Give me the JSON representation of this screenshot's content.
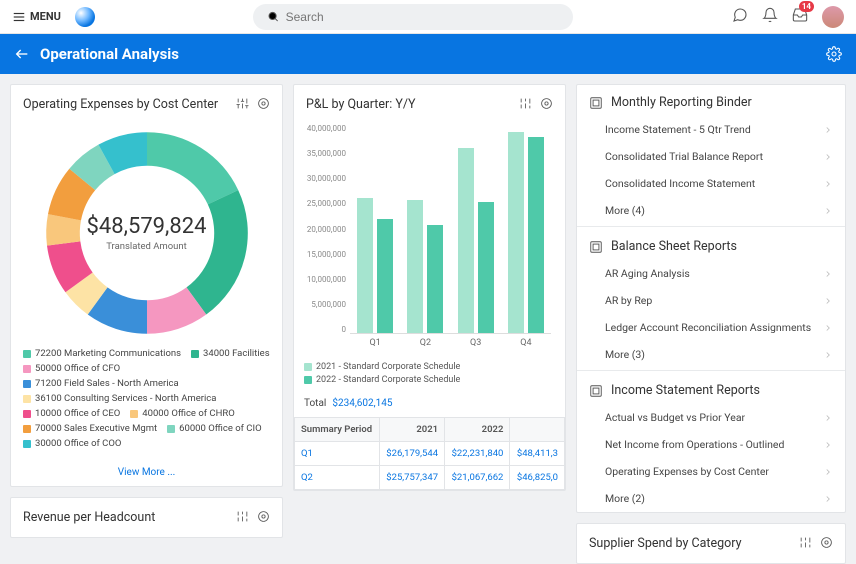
{
  "topbar": {
    "menu_label": "MENU",
    "search_placeholder": "Search",
    "inbox_badge": "14"
  },
  "header": {
    "title": "Operational Analysis"
  },
  "expense_card": {
    "title": "Operating Expenses by Cost Center",
    "center_value": "$48,579,824",
    "center_sub": "Translated Amount",
    "view_more": "View More ...",
    "legend": [
      {
        "label": "72200 Marketing Communications",
        "color": "#4fc9a9"
      },
      {
        "label": "34000 Facilities",
        "color": "#2fb58f"
      },
      {
        "label": "50000 Office of CFO",
        "color": "#f597c0"
      },
      {
        "label": "71200 Field Sales - North America",
        "color": "#3a8fd9"
      },
      {
        "label": "36100 Consulting Services - North America",
        "color": "#fde3a5"
      },
      {
        "label": "10000 Office of CEO",
        "color": "#ef4f8c"
      },
      {
        "label": "40000 Office of CHRO",
        "color": "#f9c77c"
      },
      {
        "label": "70000 Sales Executive Mgmt",
        "color": "#f29e3e"
      },
      {
        "label": "60000 Office of CIO",
        "color": "#7fd5bf"
      },
      {
        "label": "30000 Office of COO",
        "color": "#35c0cd"
      }
    ]
  },
  "chart_data": {
    "donut": {
      "type": "pie",
      "title": "Operating Expenses by Cost Center",
      "total_label": "Translated Amount",
      "total_value": 48579824,
      "slices": [
        {
          "name": "72200 Marketing Communications",
          "pct": 18,
          "color": "#4fc9a9"
        },
        {
          "name": "34000 Facilities",
          "pct": 22,
          "color": "#2fb58f"
        },
        {
          "name": "50000 Office of CFO",
          "pct": 10,
          "color": "#f597c0"
        },
        {
          "name": "71200 Field Sales - North America",
          "pct": 10,
          "color": "#3a8fd9"
        },
        {
          "name": "36100 Consulting Services - North America",
          "pct": 5,
          "color": "#fde3a5"
        },
        {
          "name": "10000 Office of CEO",
          "pct": 8,
          "color": "#ef4f8c"
        },
        {
          "name": "40000 Office of CHRO",
          "pct": 5,
          "color": "#f9c77c"
        },
        {
          "name": "70000 Sales Executive Mgmt",
          "pct": 8,
          "color": "#f29e3e"
        },
        {
          "name": "60000 Office of CIO",
          "pct": 6,
          "color": "#7fd5bf"
        },
        {
          "name": "30000 Office of COO",
          "pct": 8,
          "color": "#35c0cd"
        }
      ]
    },
    "pnl_bar": {
      "type": "bar",
      "title": "P&L by Quarter: Y/Y",
      "ylabel": "",
      "xlabel": "",
      "ylim": [
        0,
        40000000
      ],
      "yticks": [
        0,
        5000000,
        10000000,
        15000000,
        20000000,
        25000000,
        30000000,
        35000000,
        40000000
      ],
      "categories": [
        "Q1",
        "Q2",
        "Q3",
        "Q4"
      ],
      "colors": {
        "2021": "#a5e4cf",
        "2022": "#4fc9a9"
      },
      "series": [
        {
          "name": "2021 - Standard Corporate Schedule",
          "values": [
            26179544,
            25757347,
            36000000,
            39000000
          ]
        },
        {
          "name": "2022 - Standard Corporate Schedule",
          "values": [
            22231840,
            21067662,
            25500000,
            38000000
          ]
        }
      ],
      "total": "$234,602,145"
    }
  },
  "pnl_card": {
    "title": "P&L by Quarter: Y/Y",
    "legend_2021": "2021 - Standard Corporate Schedule",
    "legend_2022": "2022 - Standard Corporate Schedule",
    "total_label": "Total",
    "total_value": "$234,602,145",
    "table": {
      "headers": [
        "Summary Period",
        "2021",
        "2022",
        ""
      ],
      "rows": [
        {
          "period": "Q1",
          "y2021": "$26,179,544",
          "y2022": "$22,231,840",
          "extra": "$48,411,3"
        },
        {
          "period": "Q2",
          "y2021": "$25,757,347",
          "y2022": "$21,067,662",
          "extra": "$46,825,0"
        }
      ]
    }
  },
  "right": {
    "monthly": {
      "title": "Monthly Reporting Binder",
      "items": [
        "Income Statement - 5 Qtr Trend",
        "Consolidated Trial Balance Report",
        "Consolidated Income Statement",
        "More (4)"
      ]
    },
    "balance": {
      "title": "Balance Sheet Reports",
      "items": [
        "AR Aging Analysis",
        "AR by Rep",
        "Ledger Account Reconciliation Assignments",
        "More (3)"
      ]
    },
    "income": {
      "title": "Income Statement Reports",
      "items": [
        "Actual vs Budget vs Prior Year",
        "Net Income from Operations - Outlined",
        "Operating Expenses by Cost Center",
        "More (2)"
      ]
    },
    "supplier": {
      "title": "Supplier Spend by Category"
    }
  },
  "revenue_card": {
    "title": "Revenue per Headcount"
  },
  "yticks_fmt": [
    "40,000,000",
    "35,000,000",
    "30,000,000",
    "25,000,000",
    "20,000,000",
    "15,000,000",
    "10,000,000",
    "5,000,000",
    "0"
  ]
}
